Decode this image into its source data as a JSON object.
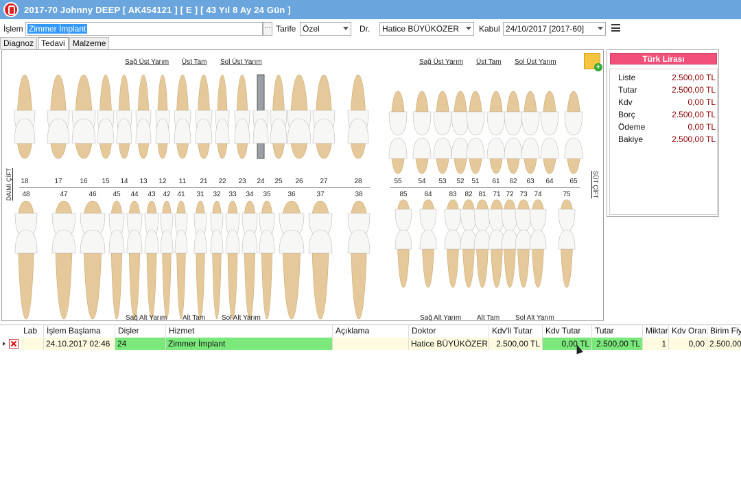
{
  "window": {
    "title": "2017-70 Johnny DEEP [ AK454121 ] [ E ] [ 43 Yıl 8 Ay 24 Gün ]"
  },
  "toolbar": {
    "islem_label": "İşlem",
    "islem_value": "Zimmer İmplant",
    "tarife_label": "Tarife",
    "tarife_value": "Özel",
    "dr_label": "Dr.",
    "dr_value": "Hatice BÜYÜKÖZER",
    "kabul_label": "Kabul",
    "kabul_value": "24/10/2017 [2017-60]"
  },
  "tabs": [
    {
      "label": "Diagnoz"
    },
    {
      "label": "Tedavi"
    },
    {
      "label": "Malzeme"
    }
  ],
  "chart": {
    "permanent": {
      "upper_labels": [
        "Sağ Üst Yarım",
        "Üst Tam",
        "Sol Üst Yarım"
      ],
      "lower_labels": [
        "Sağ Alt Yarım",
        "Alt Tam",
        "Sol Alt Yarım"
      ],
      "upper_numbers": [
        "18",
        "17",
        "16",
        "15",
        "14",
        "13",
        "12",
        "11",
        "21",
        "22",
        "23",
        "24",
        "25",
        "26",
        "27",
        "28"
      ],
      "lower_numbers": [
        "48",
        "47",
        "46",
        "45",
        "44",
        "43",
        "42",
        "41",
        "31",
        "32",
        "33",
        "34",
        "35",
        "36",
        "37",
        "38"
      ],
      "side_label": "DAİMİ ÇİFT"
    },
    "deciduous": {
      "upper_labels": [
        "Sağ Üst Yarım",
        "Üst Tam",
        "Sol Üst Yarım"
      ],
      "lower_labels": [
        "Sağ Alt Yarım",
        "Alt Tam",
        "Sol Alt Yarım"
      ],
      "upper_numbers": [
        "55",
        "54",
        "53",
        "52",
        "51",
        "61",
        "62",
        "63",
        "64",
        "65"
      ],
      "lower_numbers": [
        "85",
        "84",
        "83",
        "82",
        "81",
        "71",
        "72",
        "73",
        "74",
        "75"
      ],
      "side_label": "SÜT ÇİFT"
    }
  },
  "price": {
    "currency": "Türk Lirası",
    "rows": [
      {
        "label": "Liste",
        "value": "2.500,00 TL"
      },
      {
        "label": "Tutar",
        "value": "2.500,00 TL"
      },
      {
        "label": "Kdv",
        "value": "0,00 TL"
      },
      {
        "label": "Borç",
        "value": "2.500,00 TL"
      },
      {
        "label": "Ödeme",
        "value": "0,00 TL"
      },
      {
        "label": "Bakiye",
        "value": "2.500,00 TL"
      }
    ]
  },
  "grid": {
    "headers": {
      "lab": "Lab",
      "start": "İşlem Başlama",
      "teeth": "Dişler",
      "service": "Hizmet",
      "desc": "Açıklama",
      "doctor": "Doktor",
      "kdvli": "Kdv'li Tutar",
      "kdv": "Kdv Tutar",
      "tutar": "Tutar",
      "miktar": "Miktar",
      "kdvoran": "Kdv Oran",
      "birim": "Birim Fiyat"
    },
    "row": {
      "lab": "",
      "start": "24.10.2017 02:46",
      "teeth": "24",
      "service": "Zimmer İmplant",
      "desc": "",
      "doctor": "Hatice BÜYÜKÖZER",
      "kdvli": "2.500,00 TL",
      "kdv": "0,00 TL",
      "tutar": "2.500,00 TL",
      "miktar": "1",
      "kdvoran": "0,00",
      "birim": "2.500,00"
    }
  }
}
